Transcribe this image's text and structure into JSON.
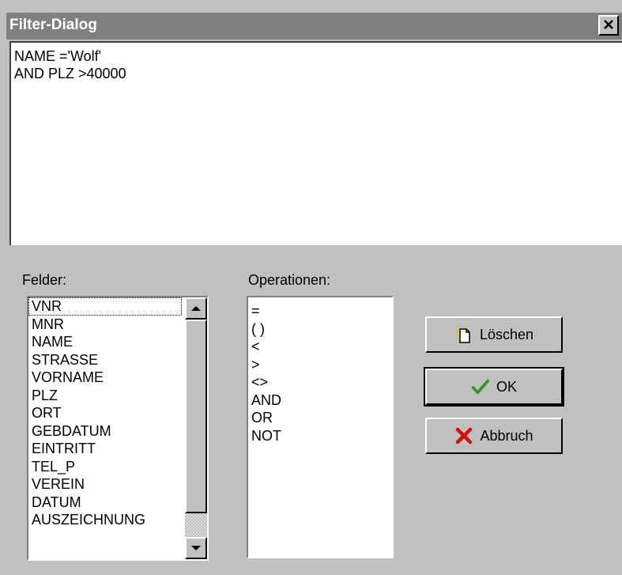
{
  "window": {
    "title": "Filter-Dialog",
    "close_symbol": "✕"
  },
  "filter_text": {
    "lines": [
      "NAME ='Wolf'",
      "AND PLZ >40000"
    ]
  },
  "fields": {
    "label": "Felder:",
    "items": [
      "VNR",
      "MNR",
      "NAME",
      "STRASSE",
      "VORNAME",
      "PLZ",
      "ORT",
      "GEBDATUM",
      "EINTRITT",
      "TEL_P",
      "VEREIN",
      "DATUM",
      "AUSZEICHNUNG"
    ],
    "selected": "VNR"
  },
  "operations": {
    "label": "Operationen:",
    "items": [
      "=",
      "( )",
      "<",
      ">",
      "<>",
      "AND",
      "OR",
      "NOT"
    ]
  },
  "buttons": {
    "clear": {
      "label": "Löschen",
      "icon": "new-document-icon"
    },
    "ok": {
      "label": "OK",
      "icon": "checkmark-icon",
      "color": "#2e9a1e"
    },
    "cancel": {
      "label": "Abbruch",
      "icon": "red-x-icon",
      "color": "#d01010"
    }
  }
}
